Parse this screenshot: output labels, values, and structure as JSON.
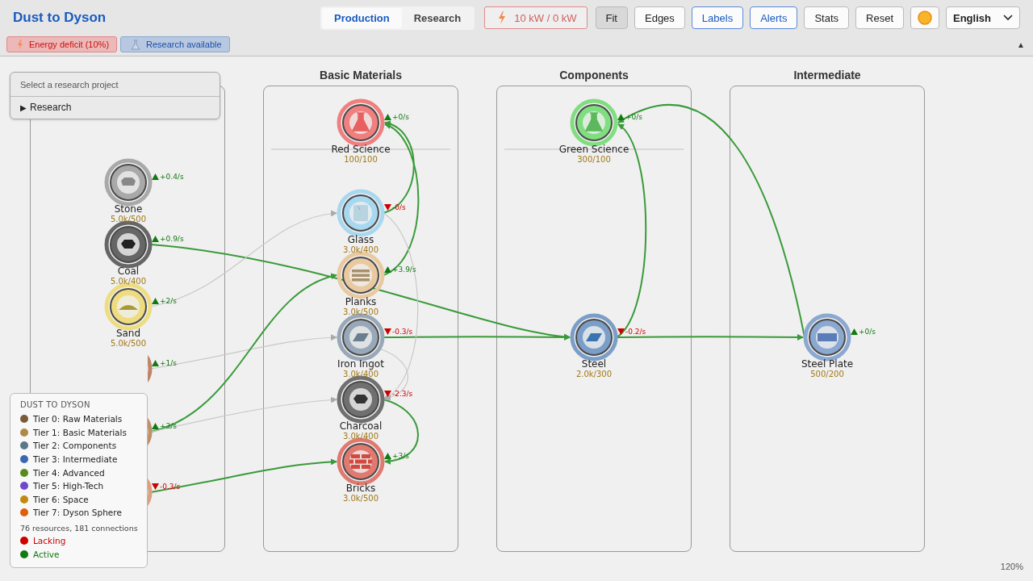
{
  "header": {
    "title": "Dust to Dyson",
    "tabs": [
      {
        "label": "Production",
        "selected": true
      },
      {
        "label": "Research",
        "selected": false
      }
    ],
    "power": {
      "reading": "10 kW / 0 kW",
      "deficit": true
    },
    "buttons": [
      {
        "label": "Fit",
        "kind": "action",
        "on": true
      },
      {
        "label": "Edges",
        "kind": "toggle",
        "on": false
      },
      {
        "label": "Labels",
        "kind": "toggle",
        "on": true
      },
      {
        "label": "Alerts",
        "kind": "toggle",
        "on": true
      },
      {
        "label": "Stats",
        "kind": "toggle",
        "on": false
      },
      {
        "label": "Reset",
        "kind": "action",
        "on": false
      }
    ],
    "language": "English",
    "alerts": [
      {
        "kind": "energy",
        "text": "Energy deficit (10%)"
      },
      {
        "kind": "research",
        "text": "Research available"
      }
    ],
    "collapse": "▲"
  },
  "research_panel": {
    "placeholder": "Select a research project",
    "section": "Research",
    "expanded": false,
    "toggle": "▶"
  },
  "lanes": [
    {
      "nodes": [
        {
          "name": "Stone",
          "amount": "5.0k/500",
          "rate": "+0.4/s",
          "lacking": false,
          "color": "#a9a9a9"
        },
        {
          "name": "Coal",
          "amount": "5.0k/400",
          "rate": "+0.9/s",
          "lacking": false,
          "color": "#666666"
        },
        {
          "name": "Sand",
          "amount": "5.0k/500",
          "rate": "+2/s",
          "lacking": false,
          "color": "#eedd80"
        },
        {
          "rate": "+1/s",
          "lacking": false,
          "color": "#c08468"
        },
        {
          "rate": "+3/s",
          "lacking": false,
          "color": "#c0906a"
        },
        {
          "rate": "-0.3/s",
          "lacking": true,
          "color": "#dca080"
        }
      ]
    },
    {
      "title": "Basic Materials",
      "nodes": [
        {
          "name": "Red Science",
          "amount": "100/100",
          "rate": "+0/s",
          "lacking": false,
          "color": "#f07f7f"
        },
        {
          "name": "Glass",
          "amount": "3.0k/400",
          "rate": "-0/s",
          "lacking": true,
          "color": "#a8d8f0"
        },
        {
          "name": "Planks",
          "amount": "3.0k/500",
          "rate": "+3.9/s",
          "lacking": false,
          "color": "#e8c9a0"
        },
        {
          "name": "Iron Ingot",
          "amount": "3.0k/400",
          "rate": "-0.3/s",
          "lacking": true,
          "color": "#98a8b8"
        },
        {
          "name": "Charcoal",
          "amount": "3.0k/400",
          "rate": "-2.3/s",
          "lacking": true,
          "color": "#707070"
        },
        {
          "name": "Bricks",
          "amount": "3.0k/500",
          "rate": "+3/s",
          "lacking": false,
          "color": "#e07a70"
        }
      ]
    },
    {
      "title": "Components",
      "nodes": [
        {
          "name": "Green Science",
          "amount": "300/100",
          "rate": "+0/s",
          "lacking": false,
          "color": "#80dd80"
        },
        {
          "name": "Steel",
          "amount": "2.0k/300",
          "rate": "-0.2/s",
          "lacking": true,
          "color": "#7a9ec8"
        }
      ]
    },
    {
      "title": "Intermediate",
      "nodes": [
        {
          "name": "Steel Plate",
          "amount": "500/200",
          "rate": "+0/s",
          "lacking": false,
          "color": "#8aa8d0"
        }
      ]
    }
  ],
  "edges": [
    {
      "active": true
    },
    {
      "active": true
    },
    {
      "active": true
    },
    {
      "active": true
    },
    {
      "active": true
    },
    {
      "active": true
    },
    {
      "active": true
    },
    {
      "active": false
    },
    {
      "active": false
    },
    {
      "active": true
    },
    {
      "active": false
    },
    {
      "active": true
    },
    {
      "active": true
    },
    {
      "active": false
    },
    {
      "active": false
    }
  ],
  "legend": {
    "title": "DUST TO DYSON",
    "tiers": [
      {
        "label": "Tier 0: Raw Materials",
        "color": "#7a5a38"
      },
      {
        "label": "Tier 1: Basic Materials",
        "color": "#ad8a48"
      },
      {
        "label": "Tier 2: Components",
        "color": "#5a7888"
      },
      {
        "label": "Tier 3: Intermediate",
        "color": "#3a68b0"
      },
      {
        "label": "Tier 4: Advanced",
        "color": "#5a8a18"
      },
      {
        "label": "Tier 5: High-Tech",
        "color": "#7048d0"
      },
      {
        "label": "Tier 6: Space",
        "color": "#c08a10"
      },
      {
        "label": "Tier 7: Dyson Sphere",
        "color": "#e05e0a"
      }
    ],
    "summary": "76 resources, 181 connections",
    "states": [
      {
        "label": "Lacking",
        "color": "#cc0000"
      },
      {
        "label": "Active",
        "color": "#117a11"
      }
    ]
  },
  "zoom": "120%"
}
